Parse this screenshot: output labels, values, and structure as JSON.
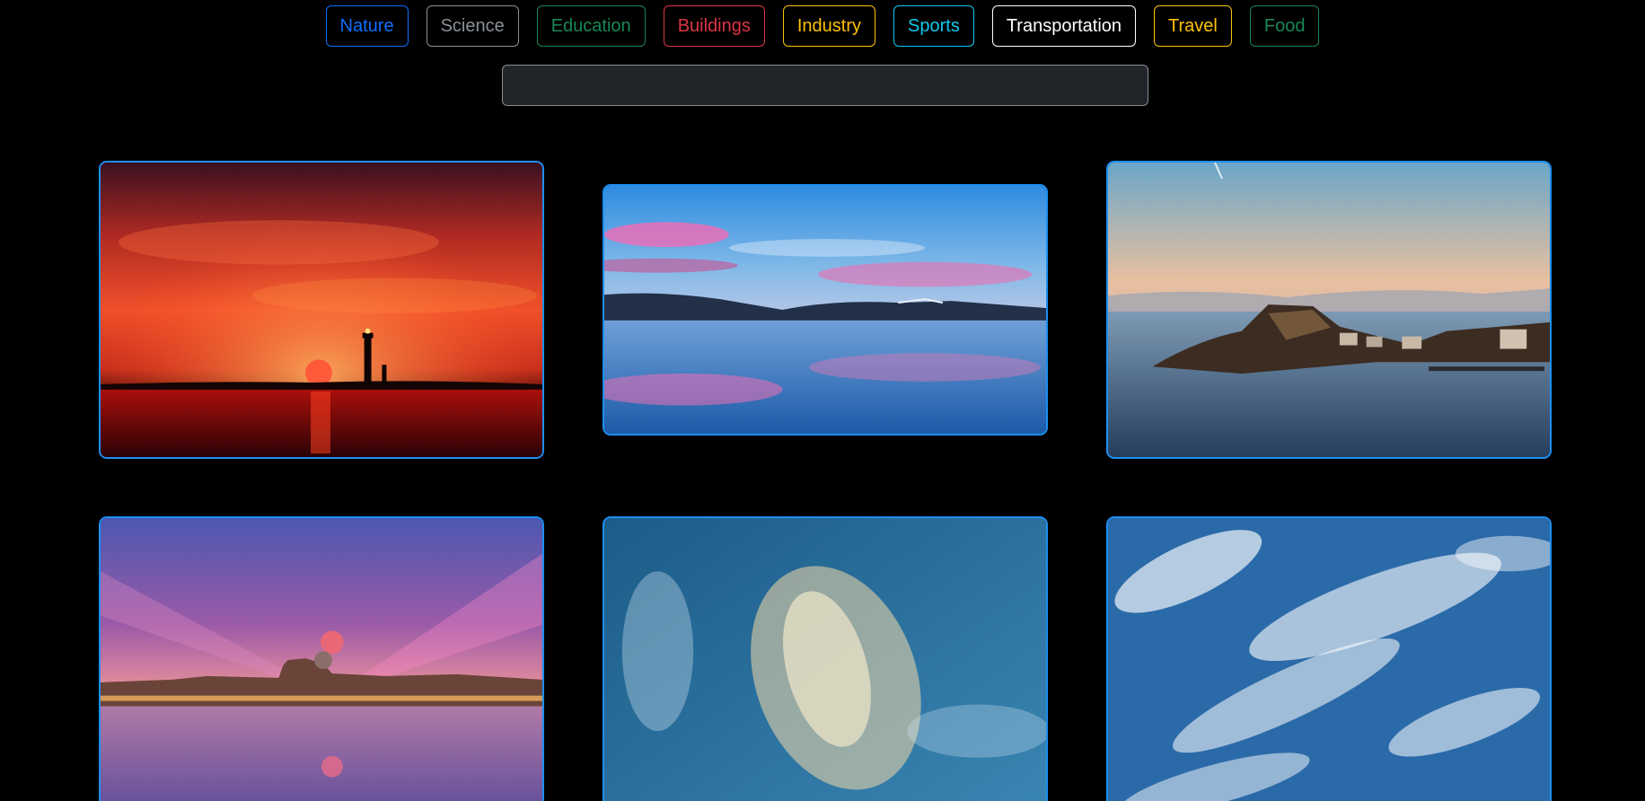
{
  "categories": [
    {
      "label": "Nature",
      "color": "#0d6efd"
    },
    {
      "label": "Science",
      "color": "#8a9097"
    },
    {
      "label": "Education",
      "color": "#198754"
    },
    {
      "label": "Buildings",
      "color": "#dc3545"
    },
    {
      "label": "Industry",
      "color": "#ffc107"
    },
    {
      "label": "Sports",
      "color": "#0dcaf0"
    },
    {
      "label": "Transportation",
      "color": "#ffffff"
    },
    {
      "label": "Travel",
      "color": "#ffc107"
    },
    {
      "label": "Food",
      "color": "#198754"
    }
  ],
  "search": {
    "value": "",
    "placeholder": ""
  },
  "colors": {
    "card_border": "#1d8ff2",
    "background": "#000000",
    "search_bg": "#212529"
  }
}
